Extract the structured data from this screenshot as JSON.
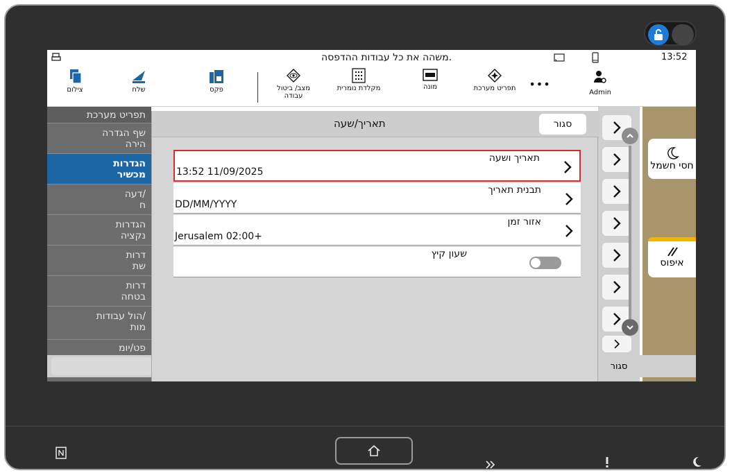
{
  "status": {
    "message": "משהה את כל עבודות ההדפסה.",
    "time": "13:52"
  },
  "toolbar": {
    "items": [
      {
        "label": "צילום",
        "icon": "copy-icon"
      },
      {
        "label": "שלח",
        "icon": "send-icon"
      },
      {
        "label": "פקס",
        "icon": "fax-icon"
      },
      {
        "label": "מצב/ ביטול עבודה",
        "icon": "eye-icon"
      },
      {
        "label": "מקלדת נומרית",
        "icon": "keypad-icon"
      },
      {
        "label": "מונה",
        "icon": "counter-icon"
      },
      {
        "label": "תפריט מערכת",
        "icon": "system-menu-icon"
      },
      {
        "label": "Admin",
        "icon": "admin-icon"
      }
    ],
    "more": "•••"
  },
  "left_panel": {
    "items": [
      {
        "label": "תפריט מערכת"
      },
      {
        "label": "שף הגדרה\nהירה"
      },
      {
        "label": "הגדרות\nמכשיר"
      },
      {
        "label": "דעה/\nח"
      },
      {
        "label": "הגדרות\nנקציה"
      },
      {
        "label": "דרות\nשת"
      },
      {
        "label": "דרות\nבטחה"
      },
      {
        "label": "הול עבודות/\nמות"
      },
      {
        "label": "פט/יומ"
      }
    ]
  },
  "dialog": {
    "title": "תאריך/שעה",
    "close_label": "סגור",
    "rows": [
      {
        "label": "תאריך ושעה",
        "value": "13:52 11/09/2025"
      },
      {
        "label": "תבנית תאריך",
        "value": "DD/MM/YYYY"
      },
      {
        "label": "אזור זמן",
        "value": "Jerusalem 02:00+"
      },
      {
        "label": "שעון קיץ",
        "value": ""
      }
    ],
    "dst_on": false
  },
  "side": {
    "sleep_label": "חסי חשמל",
    "reset_label": "איפוס",
    "bottom_close": "סגור"
  },
  "colors": {
    "accent": "#1b66a3",
    "highlight_border": "#d62c2c",
    "reset_accent": "#f0b400"
  }
}
